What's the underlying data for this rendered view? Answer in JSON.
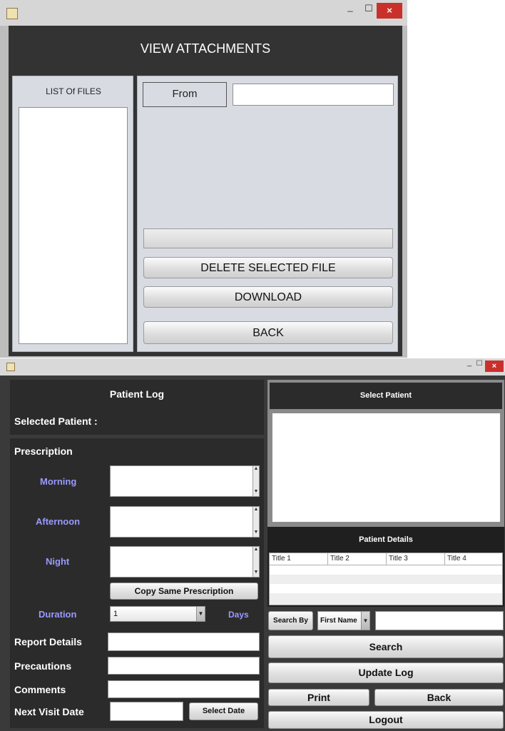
{
  "window1": {
    "title": "VIEW ATTACHMENTS",
    "list_heading": "LIST Of FILES",
    "from_label": "From",
    "from_value": "",
    "buttons": {
      "delete": "DELETE SELECTED FILE",
      "download": "DOWNLOAD",
      "back": "BACK"
    },
    "controls": {
      "minimize": "_",
      "maximize": "☐",
      "close": "×"
    }
  },
  "window2": {
    "controls": {
      "minimize": "_",
      "maximize": "☐",
      "close": "×"
    },
    "patient_log_title": "Patient Log",
    "selected_patient_label": "Selected Patient :",
    "prescription_label": "Prescription",
    "morning_label": "Morning",
    "afternoon_label": "Afternoon",
    "night_label": "Night",
    "copy_button": "Copy Same Prescription",
    "duration_label": "Duration",
    "duration_value": "1",
    "days_label": "Days",
    "report_label": "Report Details",
    "precautions_label": "Precautions",
    "comments_label": "Comments",
    "next_visit_label": "Next Visit Date",
    "select_date_button": "Select Date",
    "select_patient_title": "Select Patient",
    "patient_details_title": "Patient Details",
    "table_columns": [
      "Title 1",
      "Title 2",
      "Title 3",
      "Title 4"
    ],
    "search_by_label": "Search By",
    "search_by_value": "First Name",
    "buttons": {
      "search": "Search",
      "update_log": "Update Log",
      "print": "Print",
      "back": "Back",
      "logout": "Logout"
    },
    "colors": {
      "accent_label": "#9a99ff",
      "panel_dark": "#2b2b2b"
    }
  },
  "icons": {
    "app": "java-cup-icon",
    "spinner_up": "arrow-up-icon",
    "spinner_down": "arrow-down-icon",
    "dropdown": "chevron-down-icon"
  }
}
